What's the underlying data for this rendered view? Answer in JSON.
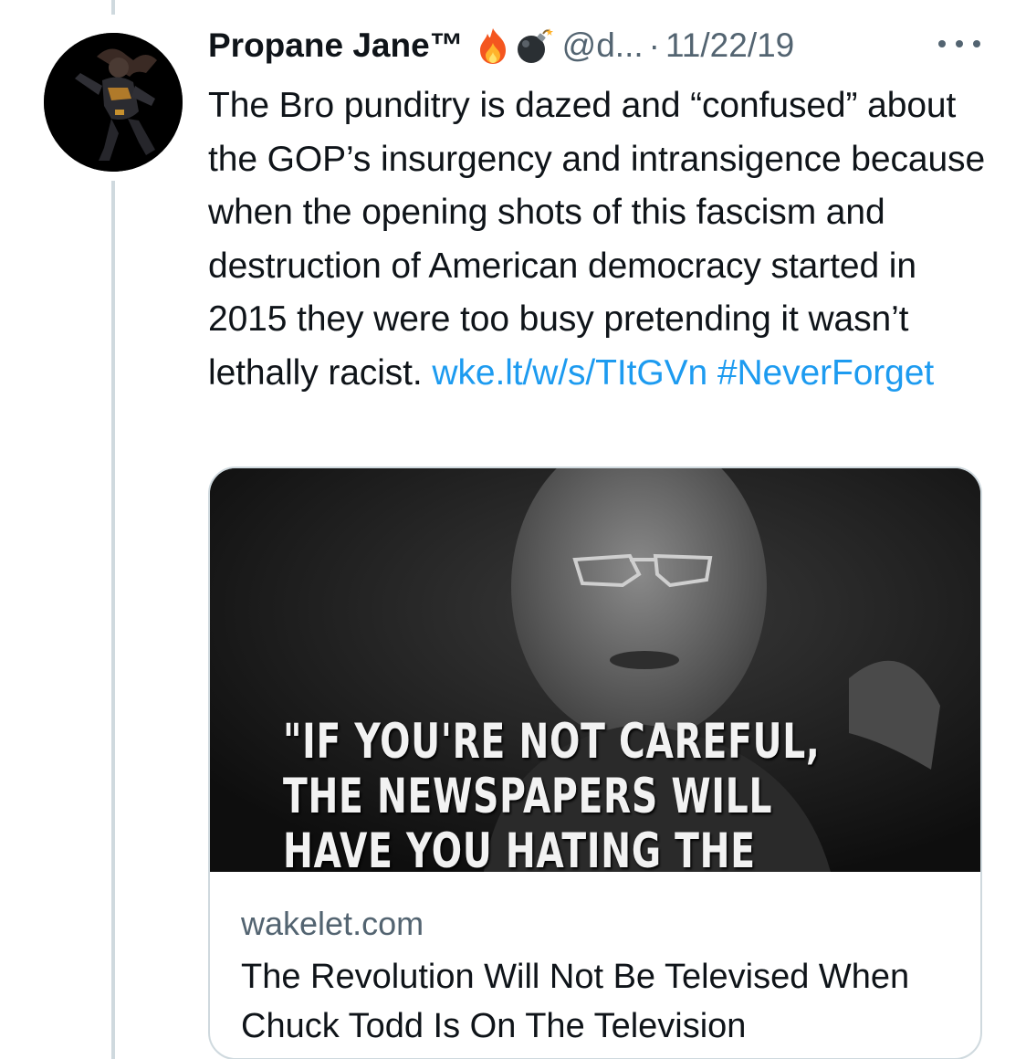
{
  "tweet": {
    "author": {
      "display_name": "Propane Jane™",
      "emoji": [
        "fire-emoji",
        "bomb-emoji"
      ],
      "handle": "@d...",
      "separator": "·",
      "date": "11/22/19"
    },
    "text_segments": {
      "body": "The Bro punditry is dazed and “confused” about the GOP’s insurgency and intransigence because when the opening shots of this fascism and destruction of American democracy started in 2015 they were too busy pretending it wasn’t lethally racist.",
      "link": "wke.lt/w/s/TItGVn",
      "hashtag": "#NeverForget"
    },
    "card": {
      "image_caption": "\"IF YOU'RE NOT CAREFUL,\nTHE NEWSPAPERS WILL\nHAVE YOU HATING THE",
      "domain": "wakelet.com",
      "title": "The Revolution Will Not Be Televised When Chuck Todd Is On The Television"
    }
  },
  "colors": {
    "link": "#1d9bf0",
    "secondary_text": "#536471",
    "border": "#cfd9de",
    "primary_text": "#0f1419"
  }
}
